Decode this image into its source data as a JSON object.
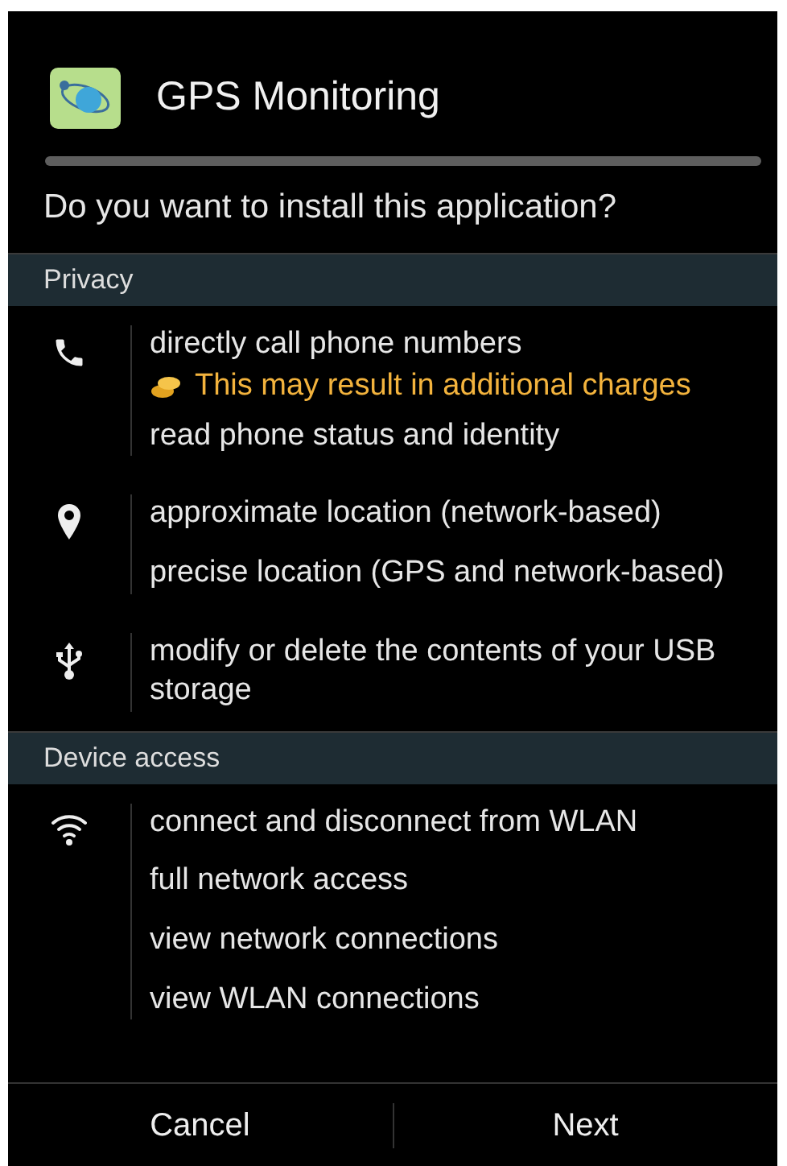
{
  "app": {
    "title": "GPS Monitoring"
  },
  "question": "Do you want to install this application?",
  "sections": [
    {
      "title": "Privacy",
      "groups": [
        {
          "kind": "phone",
          "items": [
            {
              "kind": "permission",
              "text": "directly call phone numbers"
            },
            {
              "kind": "warning",
              "text": "This may result in additional charges"
            },
            {
              "kind": "permission",
              "text": "read phone status and identity"
            }
          ]
        },
        {
          "kind": "location",
          "items": [
            {
              "kind": "permission",
              "text": "approximate location (network-based)"
            },
            {
              "kind": "permission",
              "text": "precise location (GPS and network-based)"
            }
          ]
        },
        {
          "kind": "usb",
          "items": [
            {
              "kind": "permission",
              "text": "modify or delete the contents of your USB storage"
            }
          ]
        }
      ]
    },
    {
      "title": "Device access",
      "groups": [
        {
          "kind": "wifi",
          "items": [
            {
              "kind": "permission",
              "text": "connect and disconnect from WLAN"
            },
            {
              "kind": "permission",
              "text": "full network access"
            },
            {
              "kind": "permission",
              "text": "view network connections"
            },
            {
              "kind": "permission",
              "text": "view WLAN connections"
            }
          ]
        }
      ]
    }
  ],
  "buttons": [
    "Cancel",
    "Next"
  ]
}
